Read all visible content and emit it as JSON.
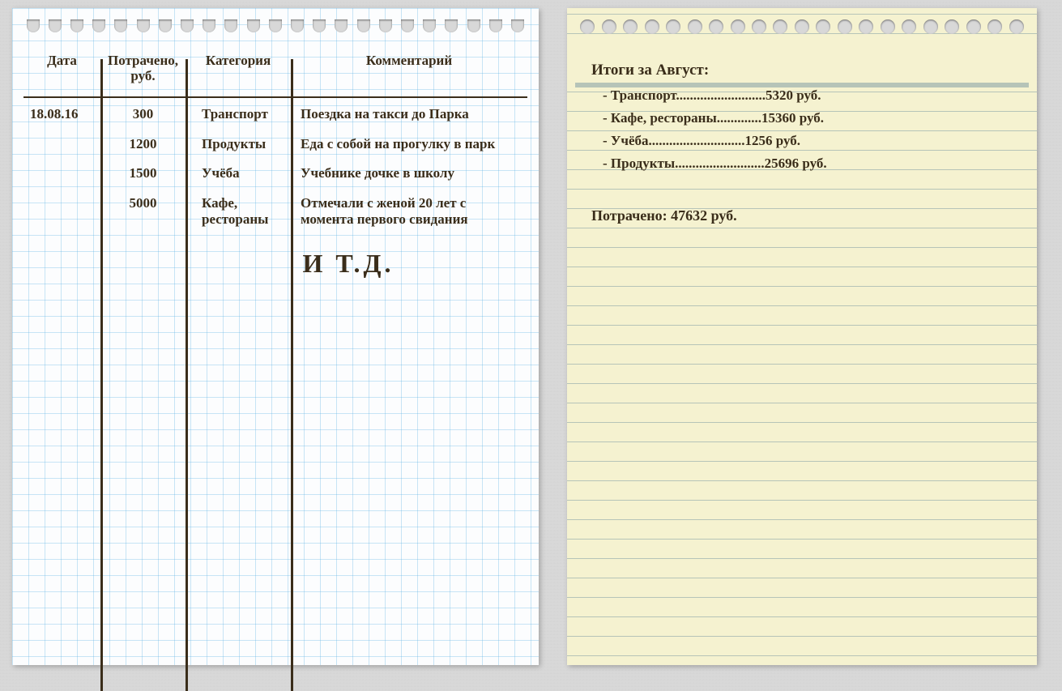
{
  "ledger": {
    "headers": {
      "date": "Дата",
      "spent": "Потрачено, руб.",
      "category": "Категория",
      "comment": "Комментарий"
    },
    "rows": [
      {
        "date": "18.08.16",
        "spent": "300",
        "category": "Транспорт",
        "comment": "Поездка на такси до Парка"
      },
      {
        "date": "",
        "spent": "1200",
        "category": "Продукты",
        "comment": "Еда с собой на прогулку в парк"
      },
      {
        "date": "",
        "spent": "1500",
        "category": "Учёба",
        "comment": "Учебнике дочке в школу"
      },
      {
        "date": "",
        "spent": "5000",
        "category": "Кафе, рестораны",
        "comment": "Отмечали с женой 20 лет с момента первого свидания"
      }
    ],
    "etc": "и т.д."
  },
  "summary": {
    "title": "Итоги за Август:",
    "items": [
      {
        "label": "Транспорт",
        "dots": "..........................",
        "value": "5320 руб."
      },
      {
        "label": "Кафе, рестораны",
        "dots": ".............",
        "value": "15360 руб."
      },
      {
        "label": "Учёба",
        "dots": "............................",
        "value": "1256 руб."
      },
      {
        "label": "Продукты",
        "dots": "..........................",
        "value": "25696 руб."
      }
    ],
    "total_label": "Потрачено:",
    "total_value": "47632 руб."
  }
}
